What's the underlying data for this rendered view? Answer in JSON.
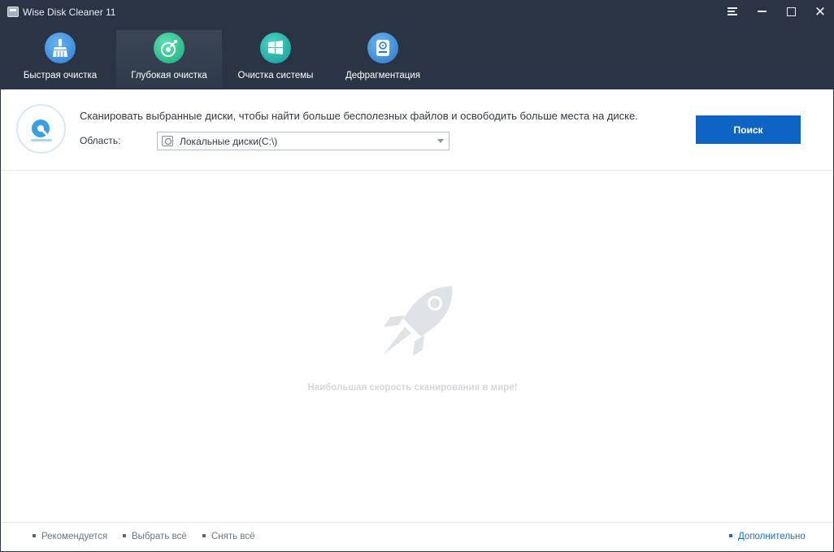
{
  "window": {
    "title": "Wise Disk Cleaner 11"
  },
  "tabs": [
    {
      "label": "Быстрая очистка",
      "icon": "broom-icon",
      "color": "#2f7fd3",
      "active": false
    },
    {
      "label": "Глубокая очистка",
      "icon": "deep-clean-disk-icon",
      "color": "#1ea978",
      "active": true
    },
    {
      "label": "Очистка системы",
      "icon": "windows-icon",
      "color": "#129c93",
      "active": false
    },
    {
      "label": "Дефрагментация",
      "icon": "hard-drive-icon",
      "color": "#2d77c9",
      "active": false
    }
  ],
  "header": {
    "description": "Сканировать выбранные диски, чтобы найти больше бесполезных файлов и освободить больше места на диске.",
    "area_label": "Область:",
    "area_value": "Локальные диски(C:\\)",
    "scan_button": "Поиск",
    "accent": "#0e64c2"
  },
  "main": {
    "tagline": "Наибольшая скорость сканирования в мире!"
  },
  "footer": {
    "recommended": "Рекомендуется",
    "select_all": "Выбрать всё",
    "deselect_all": "Снять всё",
    "more": "Дополнительно"
  }
}
